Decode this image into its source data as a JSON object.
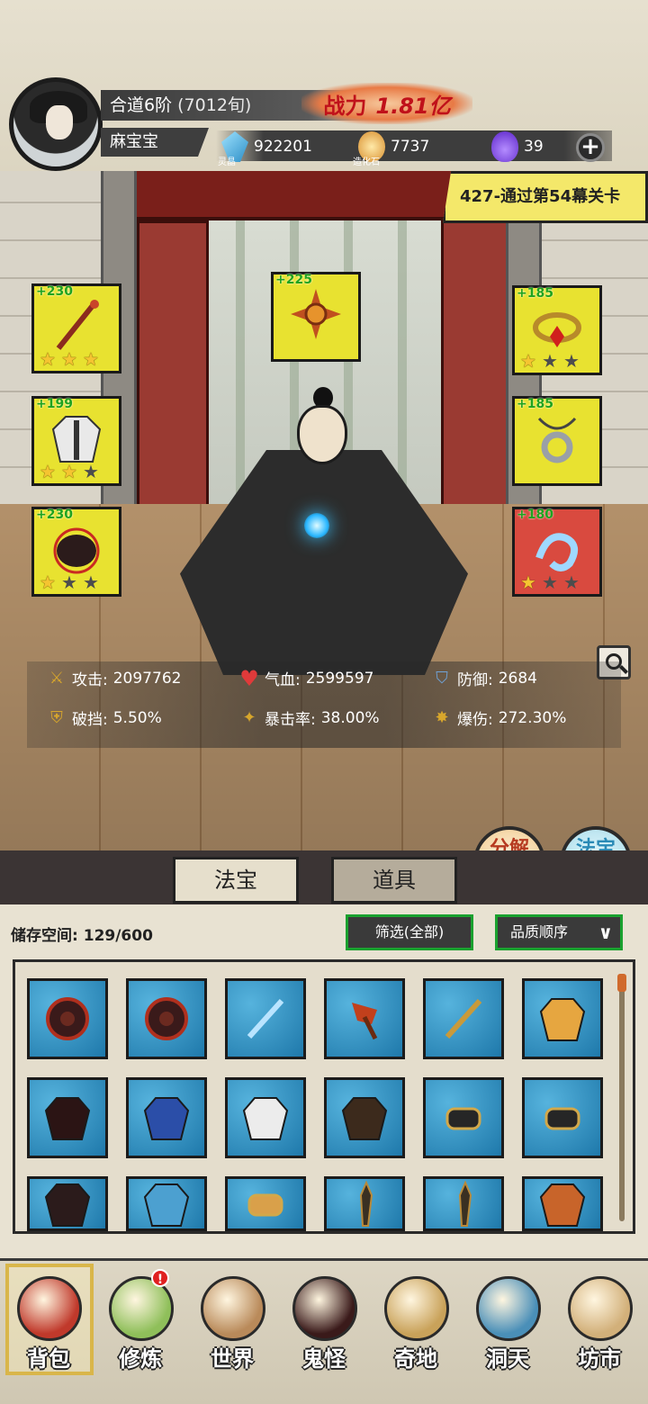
{
  "header": {
    "realm": "合道6阶",
    "realm_turns": "(7012旬)",
    "player_name": "麻宝宝",
    "power_label": "战力",
    "power_value": "1.81亿",
    "currencies": [
      {
        "icon": "spirit-crystal-icon",
        "value": "922201",
        "label": "灵晶"
      },
      {
        "icon": "creation-stone-icon",
        "value": "7737",
        "label": "造化石"
      },
      {
        "icon": "purple-flame-icon",
        "value": "39",
        "label": ""
      }
    ],
    "add_button": "+"
  },
  "stage": {
    "tag": "427-通过第54幕关卡"
  },
  "equipment": [
    {
      "slot": "weapon",
      "level": "+230",
      "stars": 3,
      "max_stars": 3,
      "quality": "yellow",
      "icon": "staff-icon"
    },
    {
      "slot": "top",
      "level": "+225",
      "stars": 0,
      "max_stars": 0,
      "quality": "yellow",
      "icon": "sun-emblem-icon"
    },
    {
      "slot": "ring",
      "level": "+185",
      "stars": 1,
      "max_stars": 3,
      "quality": "yellow",
      "icon": "bracelet-icon"
    },
    {
      "slot": "armor",
      "level": "+199",
      "stars": 2,
      "max_stars": 3,
      "quality": "yellow",
      "icon": "white-robe-icon"
    },
    {
      "slot": "necklace",
      "level": "+185",
      "stars": 0,
      "max_stars": 0,
      "quality": "yellow",
      "icon": "pendant-icon"
    },
    {
      "slot": "boots",
      "level": "+230",
      "stars": 1,
      "max_stars": 3,
      "quality": "yellow",
      "icon": "black-gauntlet-icon"
    },
    {
      "slot": "talisman",
      "level": "+180",
      "stars": 1,
      "max_stars": 3,
      "quality": "red",
      "icon": "ice-dragon-icon"
    }
  ],
  "stats": [
    {
      "icon": "sword-icon",
      "label": "攻击:",
      "value": "2097762"
    },
    {
      "icon": "heart-icon",
      "label": "气血:",
      "value": "2599597"
    },
    {
      "icon": "shield-icon",
      "label": "防御:",
      "value": "2684"
    },
    {
      "icon": "break-icon",
      "label": "破挡:",
      "value": "5.50%"
    },
    {
      "icon": "crit-icon",
      "label": "暴击率:",
      "value": "38.00%"
    },
    {
      "icon": "crit-dmg-icon",
      "label": "爆伤:",
      "value": "272.30%"
    }
  ],
  "actions": {
    "decompose": "分解再造",
    "synthesize": "法宝合成"
  },
  "tabs": [
    {
      "label": "法宝",
      "active": true
    },
    {
      "label": "道具",
      "active": false
    }
  ],
  "inventory": {
    "storage_label": "储存空间:",
    "storage_value": "129/600",
    "filter_label": "筛选(全部)",
    "sort_label": "品质顺序",
    "items": [
      "dark-wheel-icon",
      "dark-wheel-icon",
      "ice-sword-icon",
      "flame-axe-icon",
      "golden-staff-icon",
      "golden-armor-icon",
      "dark-red-robe-icon",
      "blue-fish-robe-icon",
      "white-robe-icon",
      "brown-robe-icon",
      "black-bracer-icon",
      "black-bracer-icon",
      "dark-gauntlet-icon",
      "blue-fish-icon",
      "red-gem-ring-icon",
      "dagger-icon",
      "dagger-icon",
      "lion-mask-icon"
    ]
  },
  "nav": [
    {
      "label": "背包",
      "icon": "backpack-icon",
      "active": true
    },
    {
      "label": "修炼",
      "icon": "lotus-icon",
      "active": false,
      "badge": "!"
    },
    {
      "label": "世界",
      "icon": "scroll-icon",
      "active": false
    },
    {
      "label": "鬼怪",
      "icon": "demon-egg-icon",
      "active": false
    },
    {
      "label": "奇地",
      "icon": "mystic-land-icon",
      "active": false
    },
    {
      "label": "洞天",
      "icon": "cave-heaven-icon",
      "active": false
    },
    {
      "label": "坊市",
      "icon": "market-icon",
      "active": false
    }
  ]
}
